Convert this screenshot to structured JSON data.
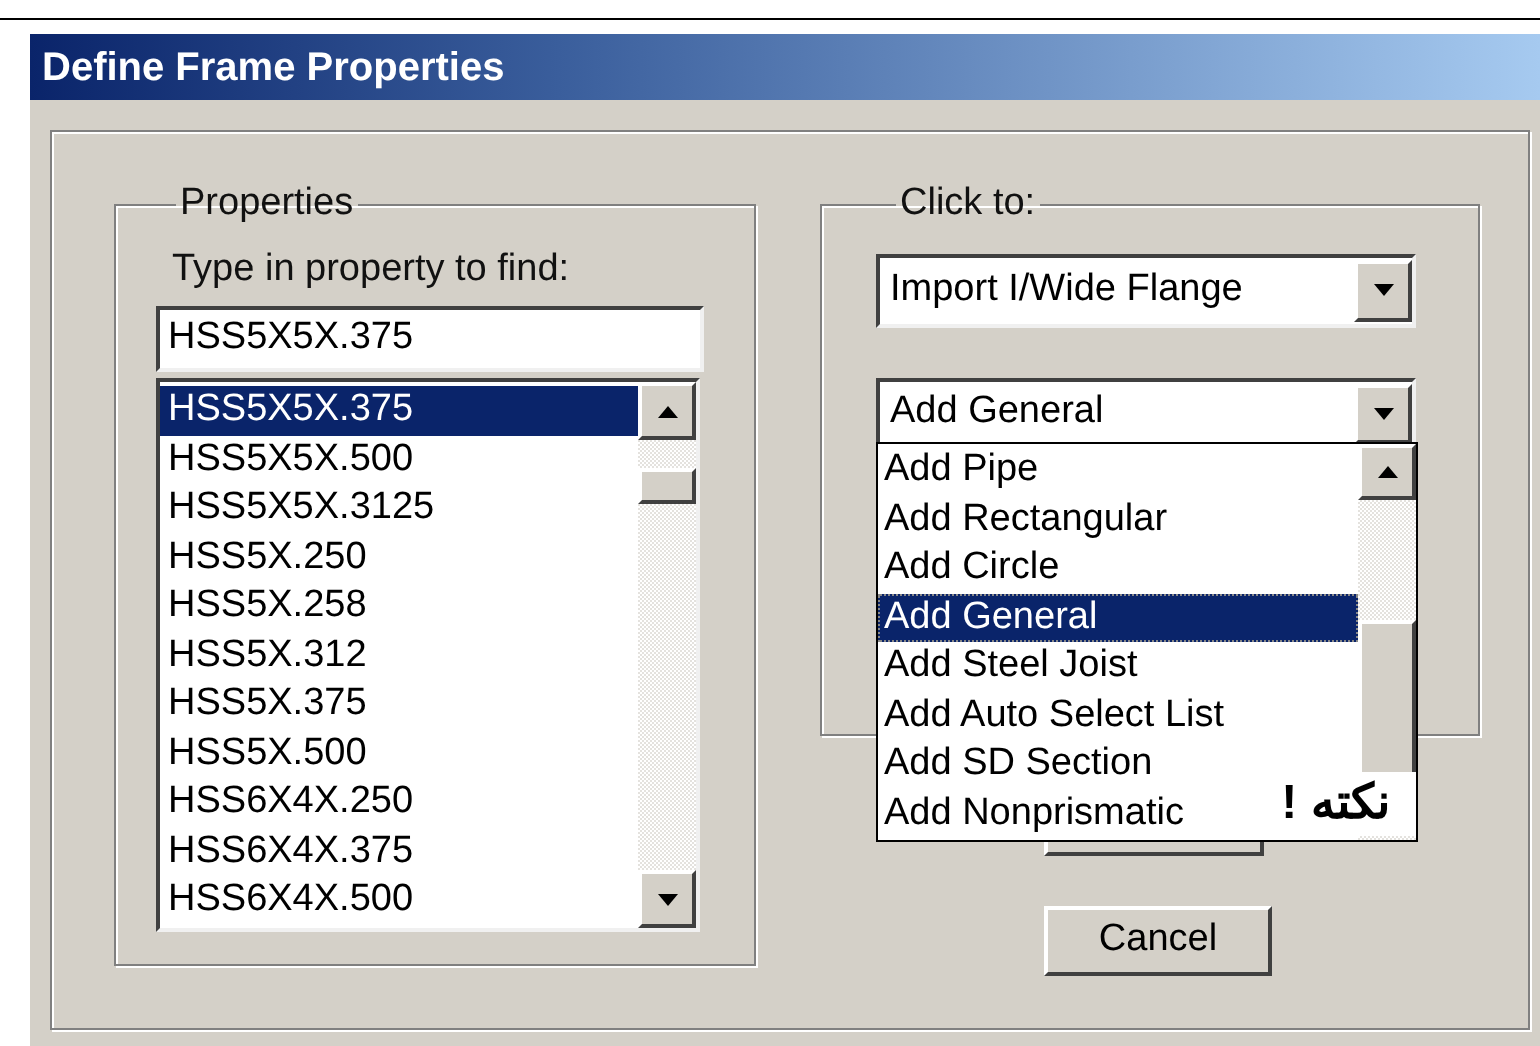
{
  "window": {
    "title": "Define Frame Properties"
  },
  "properties": {
    "legend": "Properties",
    "find_label": "Type in property to find:",
    "find_value": "HSS5X5X.375",
    "items": [
      {
        "label": "HSS5X5X.375",
        "selected": true
      },
      {
        "label": "HSS5X5X.500",
        "selected": false
      },
      {
        "label": "HSS5X5X.3125",
        "selected": false
      },
      {
        "label": "HSS5X.250",
        "selected": false
      },
      {
        "label": "HSS5X.258",
        "selected": false
      },
      {
        "label": "HSS5X.312",
        "selected": false
      },
      {
        "label": "HSS5X.375",
        "selected": false
      },
      {
        "label": "HSS5X.500",
        "selected": false
      },
      {
        "label": "HSS6X4X.250",
        "selected": false
      },
      {
        "label": "HSS6X4X.375",
        "selected": false
      },
      {
        "label": "HSS6X4X.500",
        "selected": false
      }
    ]
  },
  "click_to": {
    "legend": "Click to:",
    "import_dropdown": {
      "value": "Import I/Wide Flange"
    },
    "add_dropdown": {
      "value": "Add General",
      "expanded": true,
      "options": [
        {
          "label": "Add Pipe",
          "selected": false
        },
        {
          "label": "Add Rectangular",
          "selected": false
        },
        {
          "label": "Add Circle",
          "selected": false
        },
        {
          "label": "Add General",
          "selected": true
        },
        {
          "label": "Add Steel Joist",
          "selected": false
        },
        {
          "label": "Add Auto Select List",
          "selected": false
        },
        {
          "label": "Add SD Section",
          "selected": false
        },
        {
          "label": "Add Nonprismatic",
          "selected": false
        }
      ]
    }
  },
  "buttons": [
    {
      "label": "Cancel"
    }
  ],
  "annotation": {
    "text": "نکته !"
  }
}
